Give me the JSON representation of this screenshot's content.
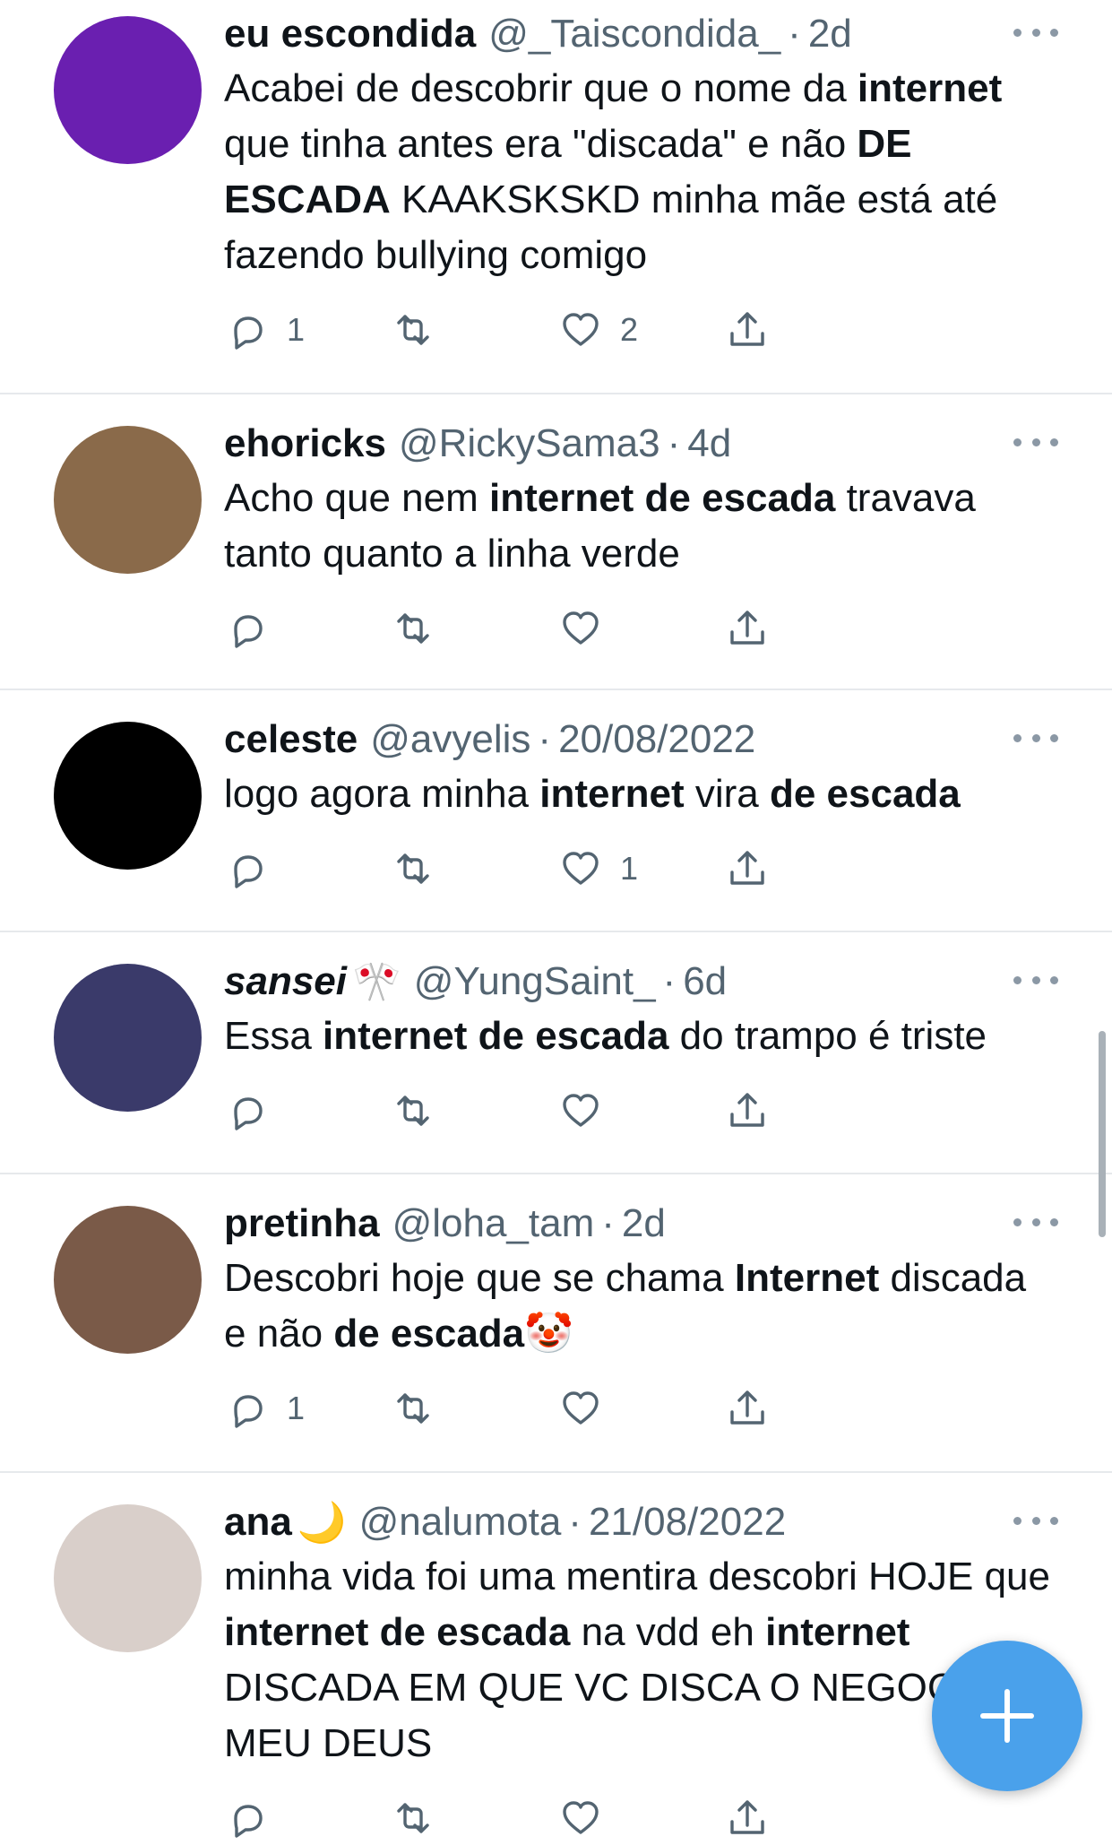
{
  "tweets": [
    {
      "name": "eu escondida",
      "handle": "@_Taiscondida_",
      "sep": "·",
      "time": "2d",
      "body_parts": [
        {
          "t": "Acabei de descobrir que o nome da "
        },
        {
          "t": "internet",
          "b": true
        },
        {
          "t": " que tinha antes era \"discada\" e não "
        },
        {
          "t": "DE ESCADA",
          "b": true
        },
        {
          "t": " KAAKSKSKD minha mãe está até fazendo bullying comigo"
        }
      ],
      "replies": "1",
      "likes": "2",
      "avatar_color": "#6a1fb0"
    },
    {
      "name": "ehoricks",
      "handle": "@RickySama3",
      "sep": "·",
      "time": "4d",
      "body_parts": [
        {
          "t": "Acho que nem "
        },
        {
          "t": "internet de escada",
          "b": true
        },
        {
          "t": " travava tanto quanto a linha verde"
        }
      ],
      "replies": "",
      "likes": "",
      "avatar_color": "#8a6a4a"
    },
    {
      "name": "celeste",
      "handle": "@avyelis",
      "sep": "·",
      "time": "20/08/2022",
      "body_parts": [
        {
          "t": "logo agora minha "
        },
        {
          "t": "internet",
          "b": true
        },
        {
          "t": " vira "
        },
        {
          "t": "de escada",
          "b": true
        }
      ],
      "replies": "",
      "likes": "1",
      "avatar_color": "#000000"
    },
    {
      "name": "sansei",
      "handle": "@YungSaint_",
      "sep": "·",
      "time": "6d",
      "badge": "🎌",
      "italic": true,
      "body_parts": [
        {
          "t": "Essa "
        },
        {
          "t": "internet de escada",
          "b": true
        },
        {
          "t": " do trampo é triste"
        }
      ],
      "replies": "",
      "likes": "",
      "avatar_color": "#3a3a6a"
    },
    {
      "name": "pretinha",
      "handle": "@loha_tam",
      "sep": "·",
      "time": "2d",
      "body_parts": [
        {
          "t": "Descobri hoje que se chama "
        },
        {
          "t": "Internet",
          "b": true
        },
        {
          "t": " discada e não "
        },
        {
          "t": "de escada",
          "b": true
        },
        {
          "t": "🤡"
        }
      ],
      "replies": "1",
      "likes": "",
      "avatar_color": "#7a5a48"
    },
    {
      "name": "ana",
      "handle": "@nalumota",
      "sep": "·",
      "time": "21/08/2022",
      "badge": "🌙",
      "body_parts": [
        {
          "t": "minha vida foi uma mentira descobri HOJE que "
        },
        {
          "t": "internet de escada",
          "b": true
        },
        {
          "t": " na vdd eh "
        },
        {
          "t": "internet",
          "b": true
        },
        {
          "t": " DISCADA EM QUE VC DISCA O NEGOCINHO MEU DEUS"
        }
      ],
      "replies": "",
      "likes": "",
      "avatar_color": "#d9cfca"
    }
  ],
  "colors": {
    "accent": "#4aa1eb",
    "secondary_text": "#536471",
    "icon": "#536471"
  },
  "icons": [
    "reply-icon",
    "retweet-icon",
    "like-icon",
    "share-icon",
    "more-icon",
    "compose-plus-icon"
  ]
}
